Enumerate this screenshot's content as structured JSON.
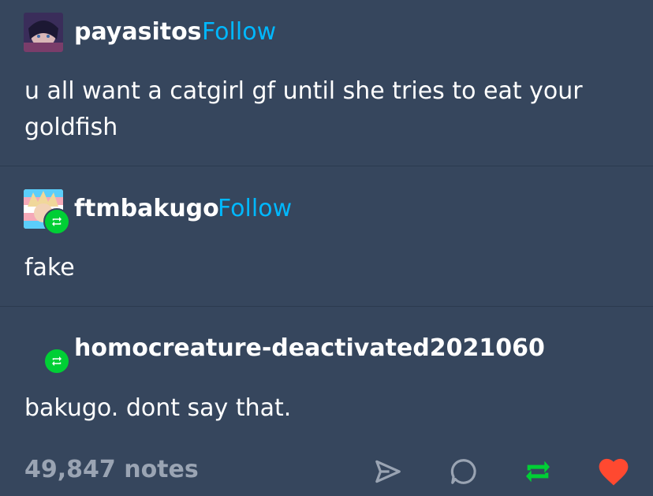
{
  "posts": [
    {
      "username": "payasitos",
      "follow_label": "Follow",
      "text": "u all want a catgirl gf until she tries to eat your goldfish",
      "avatar_icon": "anime-avatar-icon"
    },
    {
      "username": "ftmbakugo",
      "follow_label": "Follow",
      "text": "fake",
      "avatar_icon": "anime-avatar-icon",
      "badge_icon": "reblog-icon"
    },
    {
      "username": "homocreature-deactivated2021060",
      "text": "bakugo. dont say that.",
      "badge_icon": "reblog-icon"
    }
  ],
  "footer": {
    "notes": "49,847 notes",
    "actions": [
      "share-icon",
      "reply-icon",
      "reblog-icon",
      "like-icon"
    ]
  },
  "colors": {
    "background": "#36465d",
    "follow": "#00b8ff",
    "reblog": "#00cf35",
    "like": "#ff4930",
    "notes": "#9aa4b3"
  }
}
